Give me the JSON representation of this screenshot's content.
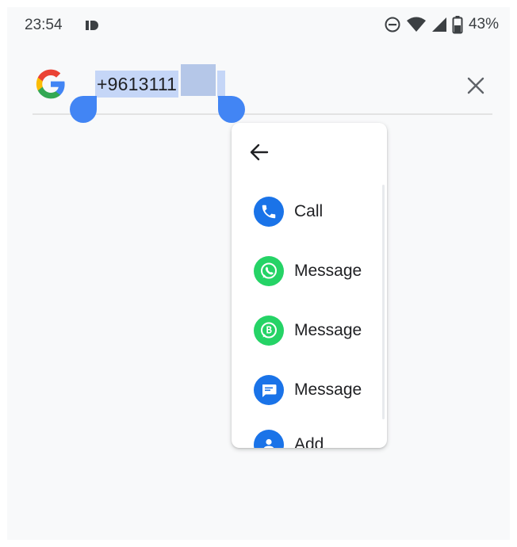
{
  "status_bar": {
    "time": "23:54",
    "battery_percent": "43%",
    "icons": [
      "id-badge-icon",
      "do-not-disturb-icon",
      "wifi-icon",
      "cell-signal-icon",
      "battery-icon"
    ]
  },
  "search": {
    "query_visible": "+9613111",
    "logo": "google-g-icon",
    "clear_icon": "close-icon"
  },
  "action_menu": {
    "back_icon": "arrow-back-icon",
    "items": [
      {
        "label": "Call",
        "icon": "phone-icon",
        "color": "#1a73e8"
      },
      {
        "label": "Message",
        "icon": "whatsapp-icon",
        "color": "#25d366"
      },
      {
        "label": "Message",
        "icon": "whatsapp-business-icon",
        "color": "#25d366"
      },
      {
        "label": "Message",
        "icon": "messages-icon",
        "color": "#1a73e8"
      },
      {
        "label": "Add",
        "icon": "add-contact-icon",
        "color": "#1a73e8"
      }
    ]
  },
  "colors": {
    "selection": "#c5d6f7",
    "handle": "#4285f4",
    "background": "#f8f9fa"
  }
}
